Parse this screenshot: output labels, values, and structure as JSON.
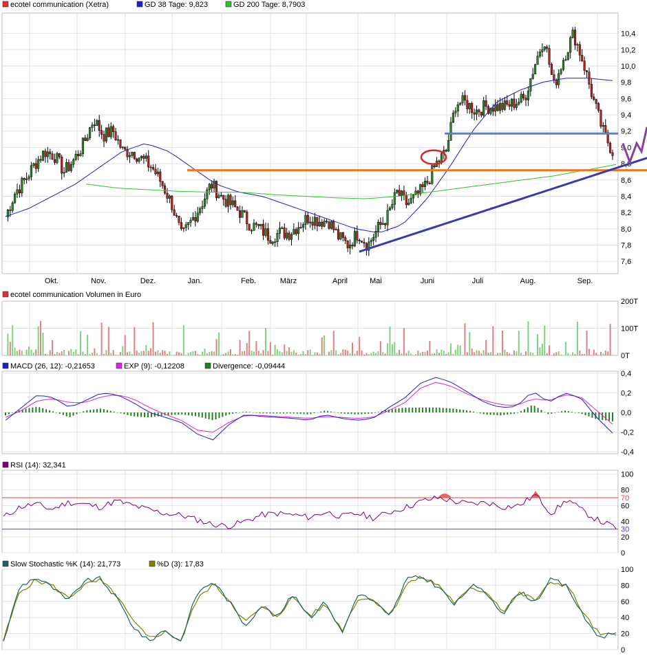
{
  "chart_data": [
    {
      "type": "candlestick",
      "panel": "price",
      "legend": [
        {
          "label": "ecotel communication (Xetra)",
          "color": "#e03030"
        },
        {
          "label": "GD 38 Tage: 9,823",
          "color": "#2020c0"
        },
        {
          "label": "GD 200 Tage: 8,7903",
          "color": "#30c030"
        }
      ],
      "ylim": [
        7.45,
        10.65
      ],
      "y_ticks": [
        "7,6",
        "7,8",
        "8,0",
        "8,2",
        "8,4",
        "8,6",
        "8,8",
        "9,0",
        "9,2",
        "9,4",
        "9,6",
        "9,8",
        "10,0",
        "10,2",
        "10,4"
      ],
      "x_labels": [
        "Okt.",
        "Nov.",
        "Dez.",
        "Jan.",
        "Feb.",
        "März",
        "April",
        "Mai",
        "Juni",
        "Juli",
        "Aug.",
        "Sep."
      ],
      "close": [
        8.15,
        8.45,
        8.6,
        8.8,
        8.95,
        8.9,
        8.7,
        8.85,
        9.05,
        9.35,
        9.15,
        9.2,
        8.95,
        8.95,
        8.85,
        8.75,
        8.55,
        8.3,
        7.9,
        8.1,
        8.3,
        8.55,
        8.4,
        8.3,
        8.2,
        8.05,
        8.0,
        7.9,
        7.95,
        7.95,
        8.05,
        8.15,
        8.1,
        8.1,
        7.9,
        7.8,
        7.95,
        7.8,
        8.0,
        8.15,
        8.45,
        8.3,
        8.4,
        8.55,
        8.8,
        8.95,
        9.55,
        9.55,
        9.45,
        9.5,
        9.5,
        9.5,
        9.55,
        9.6,
        10.0,
        10.35,
        9.75,
        10.1,
        10.4,
        10.05,
        9.6,
        9.2,
        8.95
      ],
      "ma38": [
        8.15,
        8.25,
        8.4,
        8.55,
        8.75,
        8.95,
        9.05,
        8.95,
        8.75,
        8.55,
        8.45,
        8.4,
        8.3,
        8.2,
        8.1,
        8.0,
        7.95,
        8.05,
        8.35,
        8.75,
        9.2,
        9.55,
        9.7,
        9.8,
        9.85,
        9.85,
        9.82
      ],
      "ma200": [
        8.55,
        8.5,
        8.48,
        8.46,
        8.45,
        8.45,
        8.42,
        8.4,
        8.38,
        8.37,
        8.4,
        8.45,
        8.5,
        8.55,
        8.6,
        8.65,
        8.72,
        8.79
      ],
      "volume_scale": [
        "200T",
        "100T",
        "0T"
      ],
      "annotations": {
        "horizontal_levels": [
          8.72,
          9.17
        ],
        "trendline": "rising support from April low to September"
      }
    },
    {
      "type": "bar",
      "panel": "volume",
      "title": "ecotel communication Volumen in Euro",
      "ylim": [
        0,
        200
      ],
      "y_ticks": [
        "200T",
        "100T",
        "0T"
      ]
    },
    {
      "type": "line",
      "panel": "macd",
      "legend": [
        {
          "label": "MACD (26, 12): -0,21653",
          "color": "#2020c0"
        },
        {
          "label": "EXP (9): -0,12208",
          "color": "#e020e0"
        },
        {
          "label": "Divergence: -0,09444",
          "color": "#208020"
        }
      ],
      "ylim": [
        -0.42,
        0.42
      ],
      "y_ticks": [
        "0,4",
        "0,2",
        "0,0",
        "-0,2",
        "-0,4"
      ],
      "macd": [
        -0.08,
        0.05,
        0.18,
        0.15,
        0.05,
        0.12,
        0.2,
        0.18,
        0.1,
        0.0,
        -0.05,
        -0.1,
        -0.22,
        -0.28,
        -0.12,
        -0.02,
        -0.04,
        -0.05,
        -0.06,
        -0.08,
        -0.02,
        -0.06,
        -0.08,
        -0.06,
        0.05,
        0.15,
        0.3,
        0.36,
        0.3,
        0.2,
        0.1,
        0.05,
        0.06,
        0.22,
        0.1,
        0.2,
        0.15,
        -0.05,
        -0.21
      ],
      "exp": [
        -0.05,
        0.02,
        0.12,
        0.14,
        0.1,
        0.1,
        0.16,
        0.18,
        0.14,
        0.05,
        -0.02,
        -0.08,
        -0.18,
        -0.2,
        -0.1,
        -0.03,
        -0.03,
        -0.04,
        -0.05,
        -0.06,
        -0.04,
        -0.05,
        -0.06,
        -0.05,
        0.02,
        0.1,
        0.25,
        0.31,
        0.26,
        0.18,
        0.12,
        0.08,
        0.07,
        0.14,
        0.12,
        0.18,
        0.16,
        0.02,
        -0.12
      ]
    },
    {
      "type": "line",
      "panel": "rsi",
      "legend": [
        {
          "label": "RSI (14): 32,341",
          "color": "#800080"
        }
      ],
      "ylim": [
        0,
        105
      ],
      "y_ticks": [
        "100",
        "80",
        "60",
        "40",
        "20",
        "0"
      ],
      "band_labels": [
        "70",
        "30"
      ],
      "bands": [
        30,
        70
      ],
      "rsi": [
        45,
        58,
        62,
        55,
        64,
        62,
        58,
        66,
        60,
        55,
        50,
        48,
        42,
        36,
        34,
        40,
        48,
        50,
        48,
        45,
        52,
        46,
        50,
        44,
        52,
        58,
        66,
        70,
        65,
        62,
        64,
        58,
        60,
        74,
        50,
        68,
        52,
        40,
        32
      ]
    },
    {
      "type": "line",
      "panel": "stochastic",
      "legend": [
        {
          "label": "Slow Stochastic %K (14): 21,773",
          "color": "#206060"
        },
        {
          "label": "%D (3): 17,83",
          "color": "#808000"
        }
      ],
      "ylim": [
        0,
        100
      ],
      "y_ticks": [
        "100",
        "80",
        "60",
        "40",
        "20",
        "0"
      ],
      "k": [
        10,
        78,
        90,
        78,
        60,
        85,
        88,
        65,
        30,
        10,
        25,
        10,
        70,
        85,
        60,
        30,
        55,
        40,
        70,
        40,
        60,
        20,
        70,
        60,
        40,
        88,
        90,
        78,
        55,
        80,
        70,
        45,
        72,
        60,
        88,
        78,
        40,
        15,
        22
      ],
      "d": [
        12,
        72,
        86,
        80,
        64,
        80,
        86,
        68,
        36,
        14,
        22,
        12,
        62,
        82,
        62,
        34,
        52,
        42,
        66,
        42,
        56,
        24,
        64,
        62,
        42,
        82,
        90,
        80,
        58,
        76,
        72,
        48,
        70,
        62,
        84,
        80,
        44,
        18,
        18
      ]
    }
  ]
}
